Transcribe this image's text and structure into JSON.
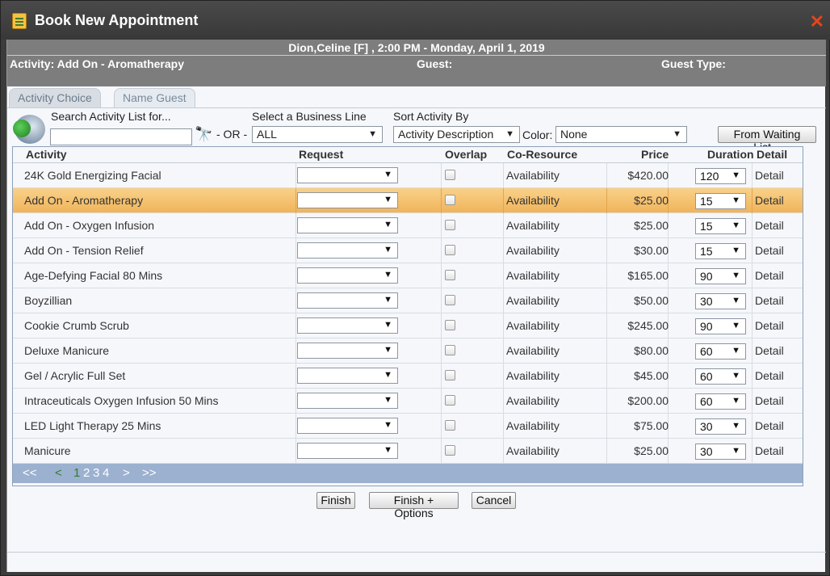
{
  "window": {
    "title": "Book New Appointment",
    "close_symbol": "✕"
  },
  "info": {
    "line1": "Dion,Celine [F] , 2:00 PM - Monday, April 1, 2019",
    "activity": "Activity: Add On - Aromatherapy",
    "guest": "Guest:",
    "guest_type": "Guest Type:"
  },
  "tabs": [
    {
      "label": "Activity Choice",
      "active": true
    },
    {
      "label": "Name Guest",
      "active": false
    }
  ],
  "filters": {
    "search_label": "Search Activity List for...",
    "search_value": "",
    "or_label": "- OR -",
    "business_line_label": "Select a Business Line",
    "business_line_value": "ALL",
    "sort_label": "Sort Activity By",
    "sort_value": "Activity Description",
    "color_label": "Color:",
    "color_value": "None",
    "waiting_list_button": "From Waiting List..."
  },
  "grid": {
    "headers": {
      "activity": "Activity",
      "request": "Request",
      "overlap": "Overlap",
      "coresource": "Co-Resource",
      "price": "Price",
      "duration": "Duration",
      "detail": "Detail"
    },
    "rows": [
      {
        "activity": "24K Gold Energizing Facial",
        "coresource": "Availability",
        "price": "$420.00",
        "duration": "120",
        "detail": "Detail",
        "selected": false
      },
      {
        "activity": "Add On - Aromatherapy",
        "coresource": "Availability",
        "price": "$25.00",
        "duration": "15",
        "detail": "Detail",
        "selected": true
      },
      {
        "activity": "Add On - Oxygen Infusion",
        "coresource": "Availability",
        "price": "$25.00",
        "duration": "15",
        "detail": "Detail",
        "selected": false
      },
      {
        "activity": "Add On - Tension Relief",
        "coresource": "Availability",
        "price": "$30.00",
        "duration": "15",
        "detail": "Detail",
        "selected": false
      },
      {
        "activity": "Age-Defying Facial 80 Mins",
        "coresource": "Availability",
        "price": "$165.00",
        "duration": "90",
        "detail": "Detail",
        "selected": false
      },
      {
        "activity": "Boyzillian",
        "coresource": "Availability",
        "price": "$50.00",
        "duration": "30",
        "detail": "Detail",
        "selected": false
      },
      {
        "activity": "Cookie Crumb Scrub",
        "coresource": "Availability",
        "price": "$245.00",
        "duration": "90",
        "detail": "Detail",
        "selected": false
      },
      {
        "activity": "Deluxe Manicure",
        "coresource": "Availability",
        "price": "$80.00",
        "duration": "60",
        "detail": "Detail",
        "selected": false
      },
      {
        "activity": "Gel / Acrylic Full Set",
        "coresource": "Availability",
        "price": "$45.00",
        "duration": "60",
        "detail": "Detail",
        "selected": false
      },
      {
        "activity": "Intraceuticals Oxygen Infusion 50 Mins",
        "coresource": "Availability",
        "price": "$200.00",
        "duration": "60",
        "detail": "Detail",
        "selected": false
      },
      {
        "activity": "LED Light Therapy 25 Mins",
        "coresource": "Availability",
        "price": "$75.00",
        "duration": "30",
        "detail": "Detail",
        "selected": false
      },
      {
        "activity": "Manicure",
        "coresource": "Availability",
        "price": "$25.00",
        "duration": "30",
        "detail": "Detail",
        "selected": false
      }
    ]
  },
  "pager": {
    "first": "<<",
    "prev": "<",
    "pages": [
      "1",
      "2",
      "3",
      "4"
    ],
    "current": "1",
    "next": ">",
    "last": ">>"
  },
  "buttons": {
    "finish": "Finish",
    "finish_options": "Finish + Options",
    "cancel": "Cancel"
  },
  "colors": {
    "selected_row": "#f3be6a",
    "close": "#e8441b",
    "pager": "#9bb1cf",
    "infobar": "#7d7d7d"
  }
}
